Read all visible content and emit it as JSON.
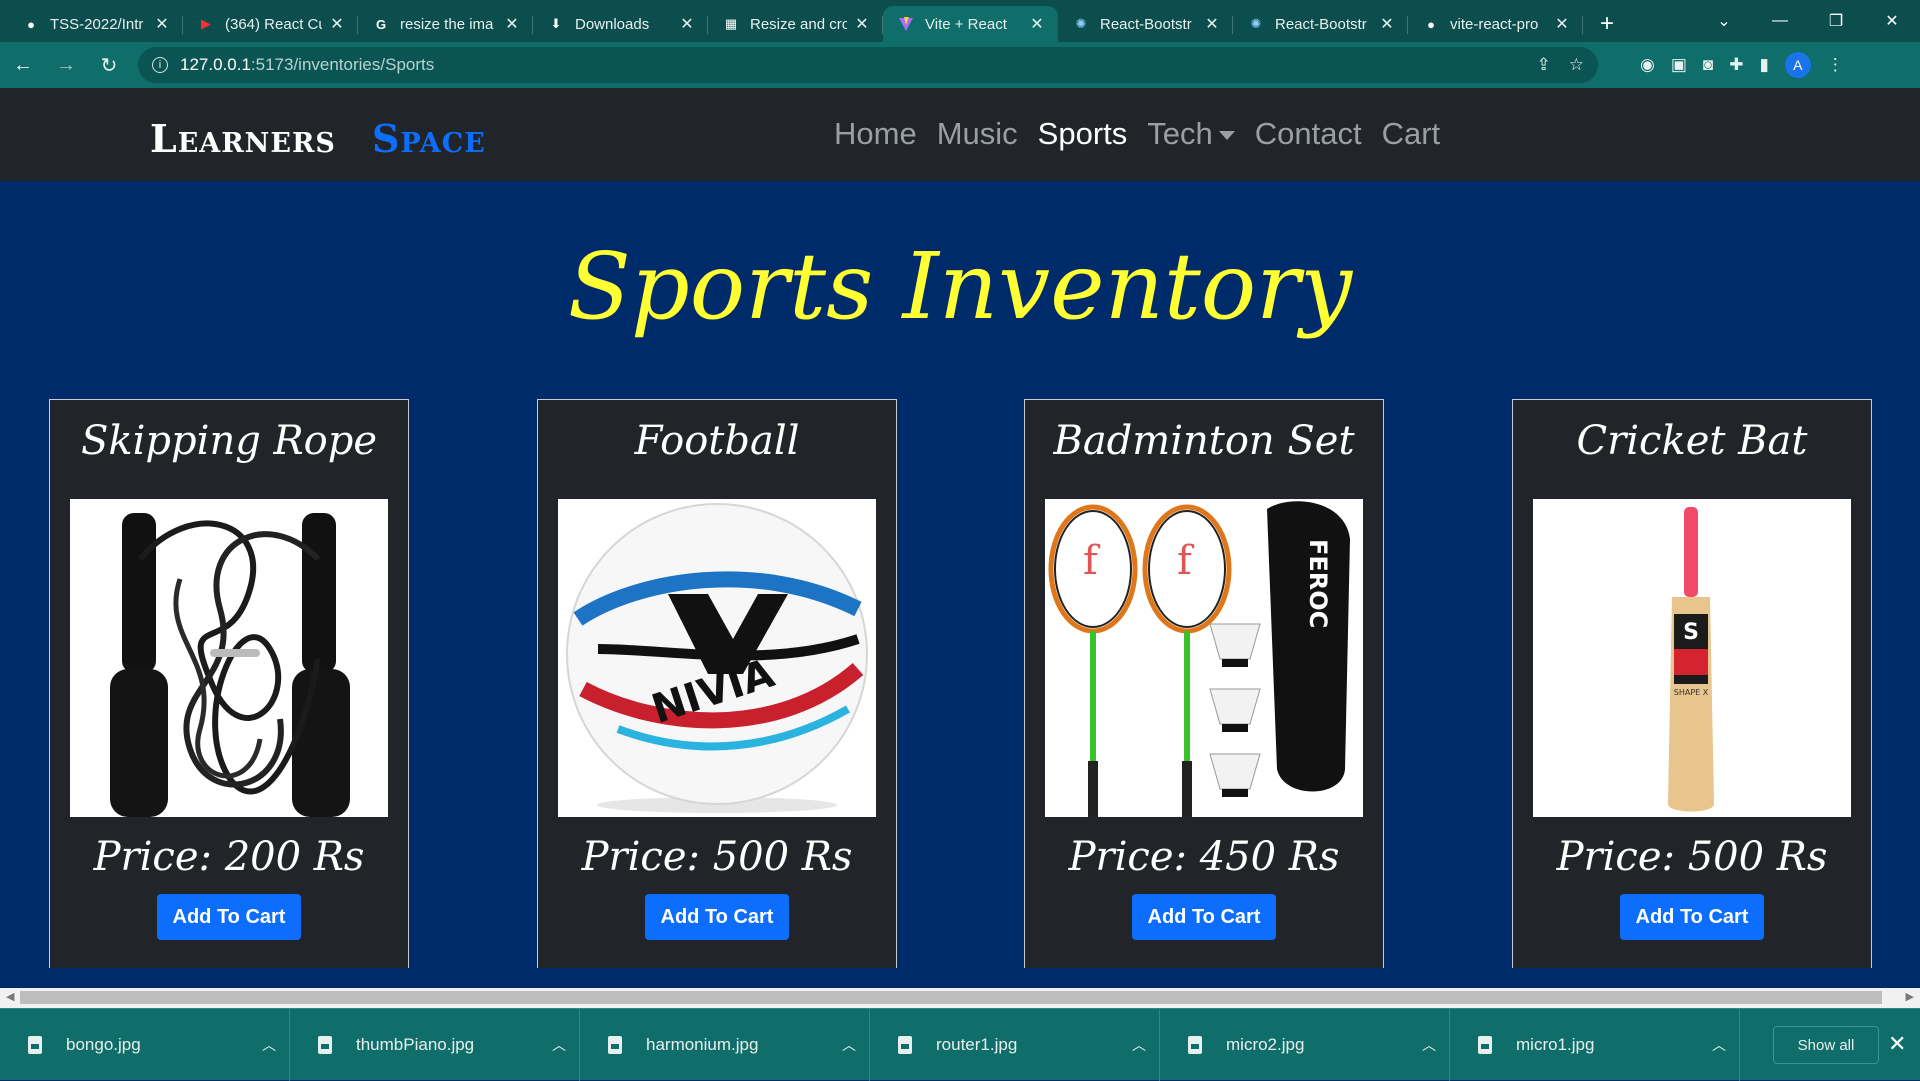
{
  "browser": {
    "tabs": [
      {
        "icon": "github-icon",
        "title": "TSS-2022/Intr"
      },
      {
        "icon": "youtube-icon",
        "title": "(364) React Cu"
      },
      {
        "icon": "google-icon",
        "title": "resize the ima"
      },
      {
        "icon": "download-icon",
        "title": "Downloads"
      },
      {
        "icon": "image-tool-icon",
        "title": "Resize and cro"
      },
      {
        "icon": "vite-icon",
        "title": "Vite + React"
      },
      {
        "icon": "react-bootstrap-icon",
        "title": "React-Bootstr"
      },
      {
        "icon": "react-bootstrap-icon",
        "title": "React-Bootstr"
      },
      {
        "icon": "github-icon",
        "title": "vite-react-pro"
      }
    ],
    "active_tab_index": 5,
    "url_host": "127.0.0.1",
    "url_path": ":5173/inventories/Sports",
    "profile_initial": "A"
  },
  "site": {
    "brand_part1": "Learners",
    "brand_part2": "Space",
    "nav": [
      {
        "label": "Home"
      },
      {
        "label": "Music"
      },
      {
        "label": "Sports"
      },
      {
        "label": "Tech"
      },
      {
        "label": "Contact"
      },
      {
        "label": "Cart"
      }
    ],
    "active_nav": "Sports",
    "page_title": "Sports Inventory"
  },
  "products": [
    {
      "name": "Skipping Rope",
      "price": "Price: 200 Rs",
      "button": "Add To Cart"
    },
    {
      "name": "Football",
      "price": "Price: 500 Rs",
      "button": "Add To Cart"
    },
    {
      "name": "Badminton Set",
      "price": "Price: 450 Rs",
      "button": "Add To Cart"
    },
    {
      "name": "Cricket Bat",
      "price": "Price: 500 Rs",
      "button": "Add To Cart"
    }
  ],
  "image_text": {
    "football_brand": "NIVIA",
    "racket_bag_brand": "FEROC",
    "bat_brand": "SHAPE X"
  },
  "downloads": [
    {
      "name": "bongo.jpg"
    },
    {
      "name": "thumbPiano.jpg"
    },
    {
      "name": "harmonium.jpg"
    },
    {
      "name": "router1.jpg"
    },
    {
      "name": "micro2.jpg"
    },
    {
      "name": "micro1.jpg"
    }
  ],
  "downloads_show_all": "Show all",
  "colors": {
    "browser_frame": "#0c4d4d",
    "navbar": "#212529",
    "page_bg": "#002b6b",
    "title_yellow": "#ffff33",
    "button_blue": "#0d6efd"
  }
}
